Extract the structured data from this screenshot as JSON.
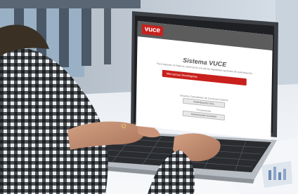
{
  "app": {
    "logo_text": "vuce",
    "title": "Sistema VUCE",
    "subtitle": "Para ingresar al Sistema, seleccione una de las siguientes opciones de autenticación",
    "primary_button_label": "Mercancías Restringidas",
    "section_one_label": "Usuarios Operadores de Comercio Exterior",
    "button_one_label": "Autenticación SOL",
    "section_two_label": "Funcionarios",
    "button_two_label": "Autenticación Extranet"
  },
  "colors": {
    "brand_red": "#c8201d",
    "laptop_body": "#4a4d52",
    "shirt_check": "#2f3236",
    "background": "#dfe7ef"
  },
  "icons": [
    "vuce-logo"
  ]
}
